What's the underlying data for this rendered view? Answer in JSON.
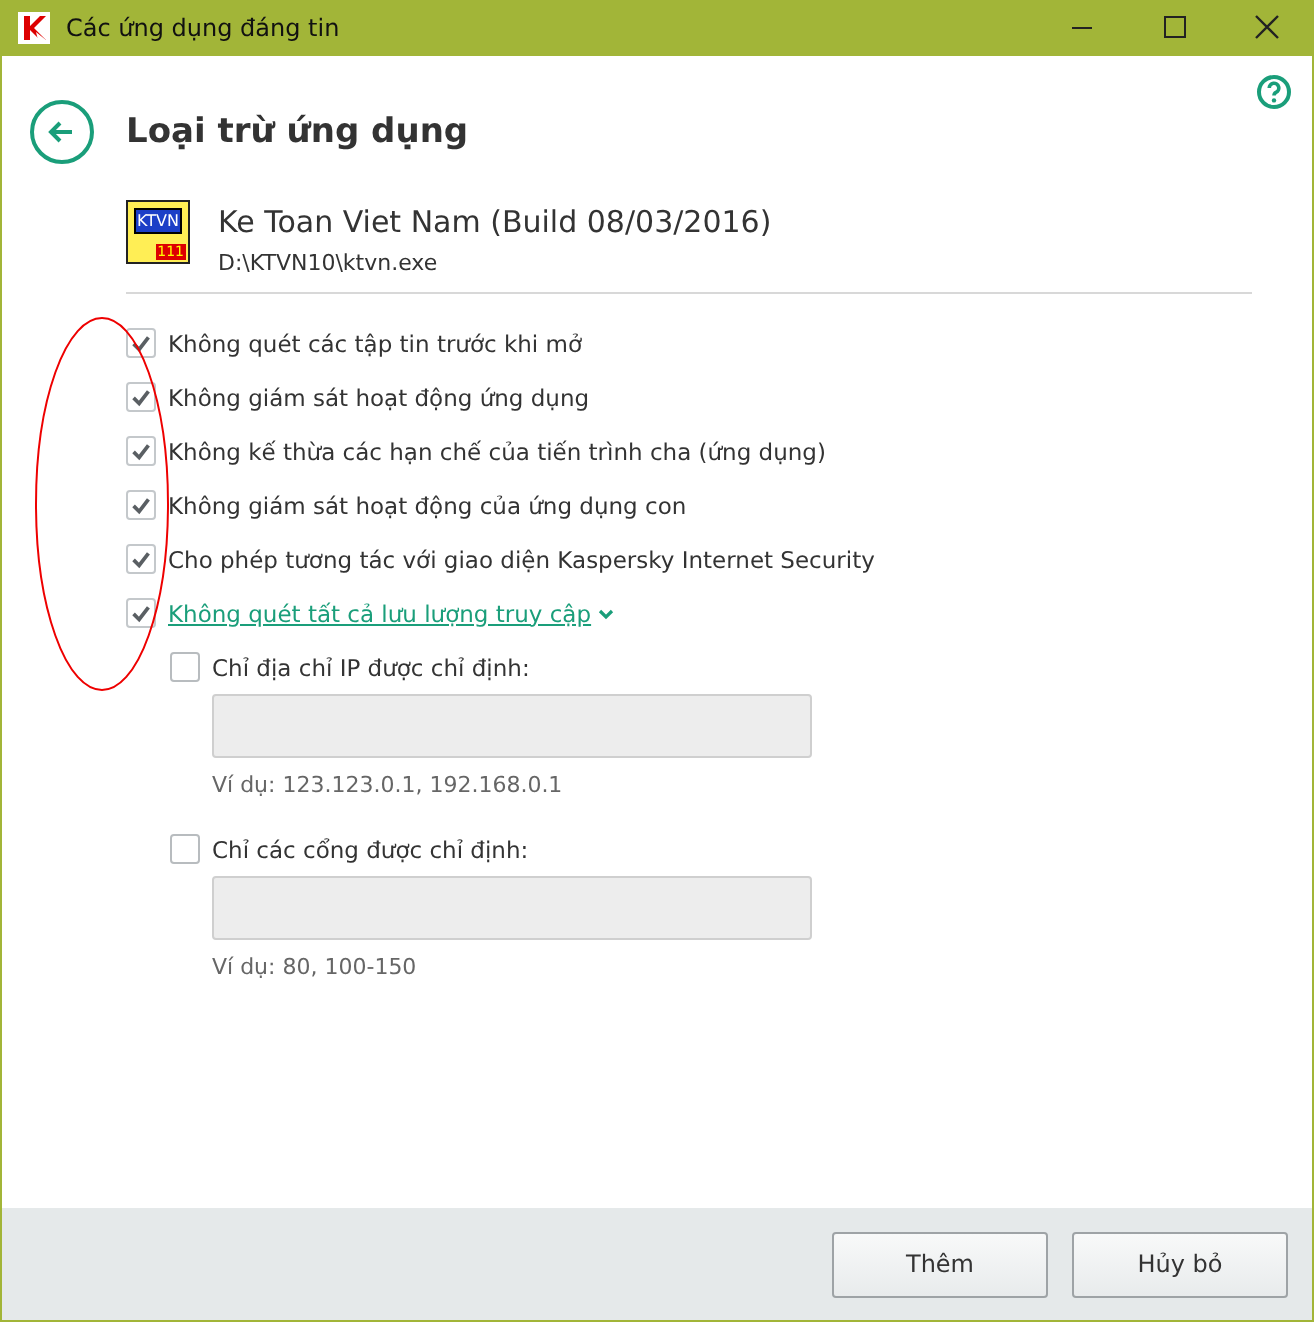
{
  "window": {
    "title": "Các ứng dụng đáng tin"
  },
  "page": {
    "title": "Loại trừ ứng dụng"
  },
  "app": {
    "name": "Ke Toan Viet Nam (Build 08/03/2016)",
    "path": "D:\\KTVN10\\ktvn.exe",
    "icon_text": "KTVN",
    "icon_badge": "111"
  },
  "options": [
    {
      "label": "Không quét các tập tin trước khi mở",
      "checked": true,
      "kind": "plain"
    },
    {
      "label": "Không giám sát hoạt động ứng dụng",
      "checked": true,
      "kind": "plain"
    },
    {
      "label": "Không kế thừa các hạn chế của tiến trình cha (ứng dụng)",
      "checked": true,
      "kind": "plain"
    },
    {
      "label": "Không giám sát hoạt động của ứng dụng con",
      "checked": true,
      "kind": "plain"
    },
    {
      "label": "Cho phép tương tác với giao diện Kaspersky Internet Security",
      "checked": true,
      "kind": "plain"
    },
    {
      "label": "Không quét tất cả lưu lượng truy cập",
      "checked": true,
      "kind": "link",
      "expanded": true
    }
  ],
  "suboptions": [
    {
      "label": "Chỉ địa chỉ IP được chỉ định:",
      "checked": false,
      "hint": "Ví dụ: 123.123.0.1, 192.168.0.1"
    },
    {
      "label": "Chỉ các cổng được chỉ định:",
      "checked": false,
      "hint": "Ví dụ: 80, 100-150"
    }
  ],
  "buttons": [
    "Thêm",
    "Hủy bỏ"
  ]
}
